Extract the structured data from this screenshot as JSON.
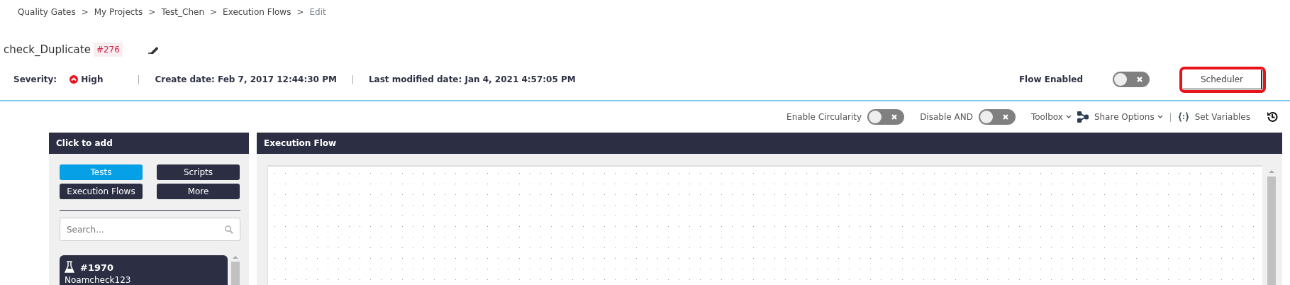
{
  "breadcrumbs": [
    {
      "label": "Quality Gates",
      "current": false
    },
    {
      "label": "My Projects",
      "current": false
    },
    {
      "label": "Test_Chen",
      "current": false
    },
    {
      "label": "Execution Flows",
      "current": false
    },
    {
      "label": "Edit",
      "current": true
    }
  ],
  "breadcrumb_separator": ">",
  "flow": {
    "name": "check_Duplicate",
    "id": "#276"
  },
  "meta": {
    "severity_label": "Severity:",
    "severity": "High",
    "create_date": "Create date: Feb 7, 2017 12:44:30 PM",
    "modified_date": "Last modified date: Jan 4, 2021 4:57:05 PM"
  },
  "flow_enabled": {
    "label": "Flow Enabled",
    "on": false
  },
  "scheduler": {
    "label": "Scheduler",
    "highlighted": true
  },
  "toolbar": {
    "enable_circularity": {
      "label": "Enable Circularity",
      "on": false
    },
    "disable_and": {
      "label": "Disable AND",
      "on": false
    },
    "toolbox": "Toolbox",
    "share_options": "Share Options",
    "set_variables": "Set Variables"
  },
  "add_panel": {
    "title": "Click to add",
    "tabs": [
      {
        "label": "Tests",
        "selected": true
      },
      {
        "label": "Scripts",
        "selected": false
      },
      {
        "label": "Execution Flows",
        "selected": false
      },
      {
        "label": "More",
        "selected": false
      }
    ],
    "search": {
      "placeholder": "Search..."
    },
    "items": [
      {
        "id": "#1970",
        "name": "Noamcheck123"
      }
    ]
  },
  "flow_panel": {
    "title": "Execution Flow"
  }
}
